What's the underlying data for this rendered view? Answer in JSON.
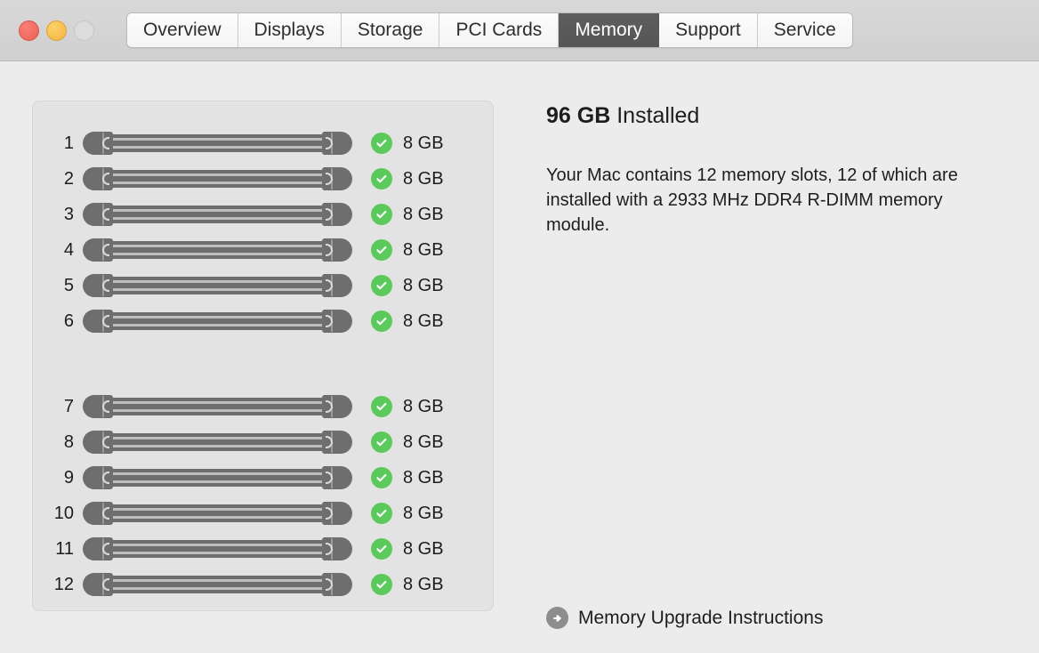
{
  "window": {
    "traffic_lights": [
      {
        "name": "close",
        "color": "#ee6a5f"
      },
      {
        "name": "minimize",
        "color": "#f5bd4c"
      },
      {
        "name": "zoom",
        "color": "#dcdcdc"
      }
    ]
  },
  "toolbar": {
    "tabs": [
      {
        "label": "Overview",
        "selected": false
      },
      {
        "label": "Displays",
        "selected": false
      },
      {
        "label": "Storage",
        "selected": false
      },
      {
        "label": "PCI Cards",
        "selected": false
      },
      {
        "label": "Memory",
        "selected": true
      },
      {
        "label": "Support",
        "selected": false
      },
      {
        "label": "Service",
        "selected": false
      }
    ],
    "selected_tab": "Memory",
    "selected_tab_bg": "#585858",
    "selected_tab_color": "#ffffff"
  },
  "memory": {
    "status_ok_color": "#5cc95c",
    "status_icon": "check-circle-icon",
    "group_one": [
      {
        "slot": "1",
        "size": "8 GB",
        "status": "ok"
      },
      {
        "slot": "2",
        "size": "8 GB",
        "status": "ok"
      },
      {
        "slot": "3",
        "size": "8 GB",
        "status": "ok"
      },
      {
        "slot": "4",
        "size": "8 GB",
        "status": "ok"
      },
      {
        "slot": "5",
        "size": "8 GB",
        "status": "ok"
      },
      {
        "slot": "6",
        "size": "8 GB",
        "status": "ok"
      }
    ],
    "group_two": [
      {
        "slot": "7",
        "size": "8 GB",
        "status": "ok"
      },
      {
        "slot": "8",
        "size": "8 GB",
        "status": "ok"
      },
      {
        "slot": "9",
        "size": "8 GB",
        "status": "ok"
      },
      {
        "slot": "10",
        "size": "8 GB",
        "status": "ok"
      },
      {
        "slot": "11",
        "size": "8 GB",
        "status": "ok"
      },
      {
        "slot": "12",
        "size": "8 GB",
        "status": "ok"
      }
    ]
  },
  "info": {
    "installed_amount": "96 GB",
    "installed_suffix": "Installed",
    "description": "Your Mac contains 12 memory slots, 12 of which are installed with a 2933 MHz DDR4 R-DIMM memory module.",
    "upgrade_link_label": "Memory Upgrade Instructions",
    "upgrade_link_icon": "arrow-right-circle-icon"
  }
}
